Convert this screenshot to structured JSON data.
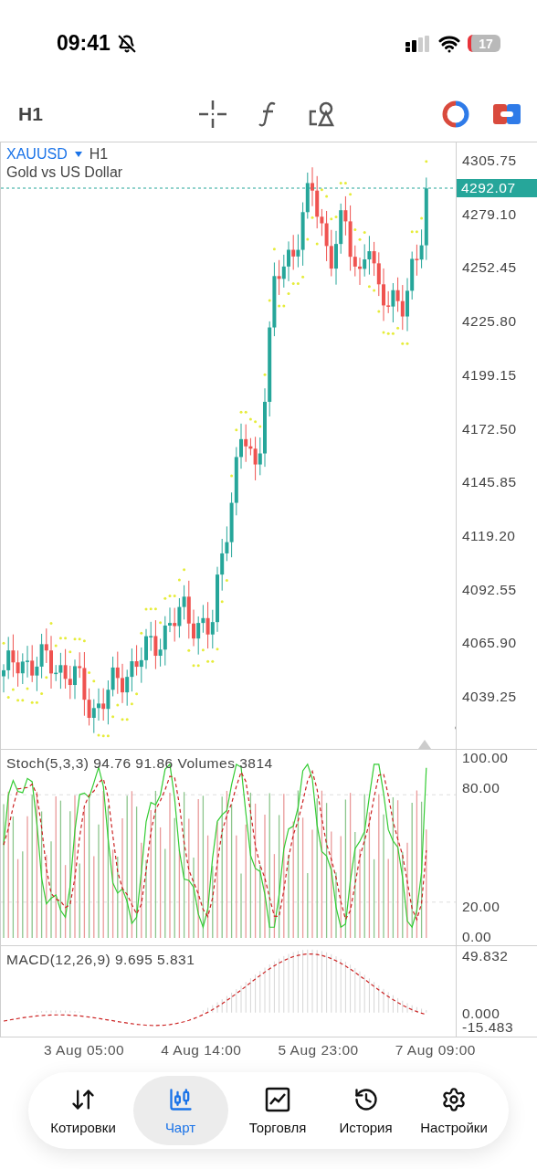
{
  "status_bar": {
    "time": "09:41",
    "battery": "17"
  },
  "toolbar": {
    "timeframe": "H1"
  },
  "chart": {
    "symbol": "XAUUSD",
    "timeframe": "H1",
    "description": "Gold vs US Dollar",
    "current_price": "4292.07",
    "price_labels": [
      "4305.75",
      "4279.10",
      "4252.45",
      "4225.80",
      "4199.15",
      "4172.50",
      "4145.85",
      "4119.20",
      "4092.55",
      "4065.90",
      "4039.25"
    ]
  },
  "stochastic": {
    "legend": "Stoch(5,3,3) 94.76 91.86 Volumes 3814",
    "levels": [
      "100.00",
      "80.00",
      "20.00",
      "0.00"
    ]
  },
  "macd": {
    "legend": "MACD(12,26,9) 9.695 5.831",
    "levels": [
      "49.832",
      "0.000",
      "-15.483"
    ]
  },
  "time_axis": [
    "3 Aug 05:00",
    "4 Aug 14:00",
    "5 Aug 23:00",
    "7 Aug 09:00"
  ],
  "nav": [
    {
      "label": "Котировки",
      "kind": "quotes",
      "selected": false
    },
    {
      "label": "Чарт",
      "kind": "chart",
      "selected": true
    },
    {
      "label": "Торговля",
      "kind": "trade",
      "selected": false
    },
    {
      "label": "История",
      "kind": "history",
      "selected": false
    },
    {
      "label": "Настройки",
      "kind": "settings",
      "selected": false
    }
  ]
}
